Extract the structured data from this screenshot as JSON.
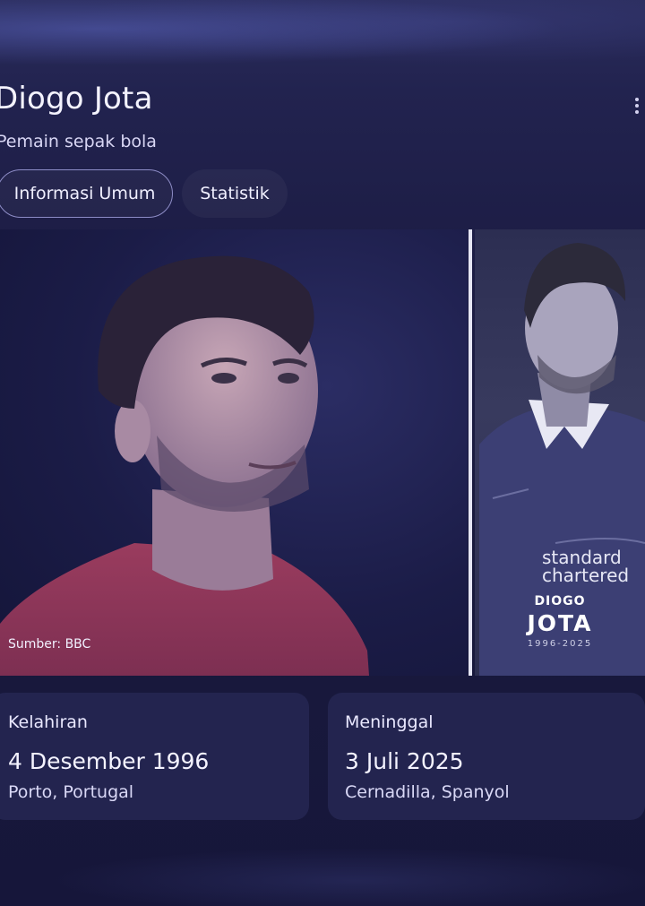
{
  "entity": {
    "name": "Diogo Jota",
    "description": "Pemain sepak bola"
  },
  "tabs": [
    {
      "label": "Informasi Umum",
      "active": true
    },
    {
      "label": "Statistik",
      "active": false
    }
  ],
  "images": {
    "main_caption": "Sumber: BBC",
    "tribute": {
      "first_name": "DIOGO",
      "last_name": "JOTA",
      "years": "1996-2025",
      "sponsor": "standard chartered"
    }
  },
  "facts": {
    "birth": {
      "label": "Kelahiran",
      "date": "4 Desember 1996",
      "place": "Porto, Portugal"
    },
    "death": {
      "label": "Meninggal",
      "date": "3 Juli 2025",
      "place": "Cernadilla, Spanyol"
    }
  },
  "icons": {
    "more": "more-vertical-icon"
  },
  "colors": {
    "background": "#1c1c44",
    "card": "#23244f",
    "tab_border": "#8d8cc6"
  }
}
